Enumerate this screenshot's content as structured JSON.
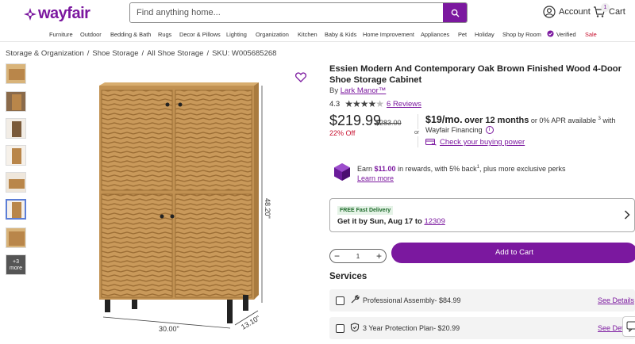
{
  "header": {
    "logo_text": "wayfair",
    "search_placeholder": "Find anything home...",
    "account_label": "Account",
    "cart_label": "Cart",
    "cart_count": "1"
  },
  "nav": {
    "items": [
      "Furniture",
      "Outdoor",
      "Bedding & Bath",
      "Rugs",
      "Decor & Pillows",
      "Lighting",
      "Organization",
      "Kitchen",
      "Baby & Kids",
      "Home Improvement",
      "Appliances",
      "Pet",
      "Holiday",
      "Shop by Room",
      "Verified",
      "Sale"
    ]
  },
  "breadcrumb": {
    "items": [
      "Storage & Organization",
      "Shoe Storage",
      "All Shoe Storage",
      "SKU: W005685268"
    ],
    "separator": "/"
  },
  "gallery": {
    "more_label": "+3 more",
    "dim_width": "30.00\"",
    "dim_height": "48.20\"",
    "dim_depth": "13.10\""
  },
  "product": {
    "title": "Essien Modern And Contemporary Oak Brown Finished Wood 4-Door Shoe Storage Cabinet",
    "by_label": "By",
    "brand": "Lark Manor™",
    "rating_value": "4.3",
    "rating_stars": 4.3,
    "reviews_link": "6 Reviews",
    "price": "$219.99",
    "old_price": "$283.00",
    "discount": "22% Off",
    "or_label": "or",
    "finance_monthly": "$19/mo.",
    "finance_terms": "over 12 months",
    "finance_apr": "or 0% APR available",
    "finance_sup": "3",
    "finance_with": "with",
    "finance_provider": "Wayfair Financing",
    "buying_power_link": "Check your buying power"
  },
  "rewards": {
    "text_pre": "Earn",
    "amount": "$11.00",
    "text_mid": "in rewards, with 5% back",
    "sup": "1",
    "text_post": ", plus more exclusive perks",
    "learn_more": "Learn more"
  },
  "shipping": {
    "badge": "FREE Fast Delivery",
    "line": "Get it by Sun, Aug 17 to",
    "zip": "12309"
  },
  "cart_actions": {
    "quantity": "1",
    "add_to_cart": "Add to Cart"
  },
  "services": {
    "heading": "Services",
    "items": [
      {
        "label": "Professional Assembly- $84.99",
        "link": "See Details"
      },
      {
        "label": "3 Year Protection Plan- $20.99",
        "link": "See Deta"
      }
    ]
  },
  "colors": {
    "brand_purple": "#7b189f",
    "sale_red": "#c7102e",
    "wood": "#c9995a"
  }
}
